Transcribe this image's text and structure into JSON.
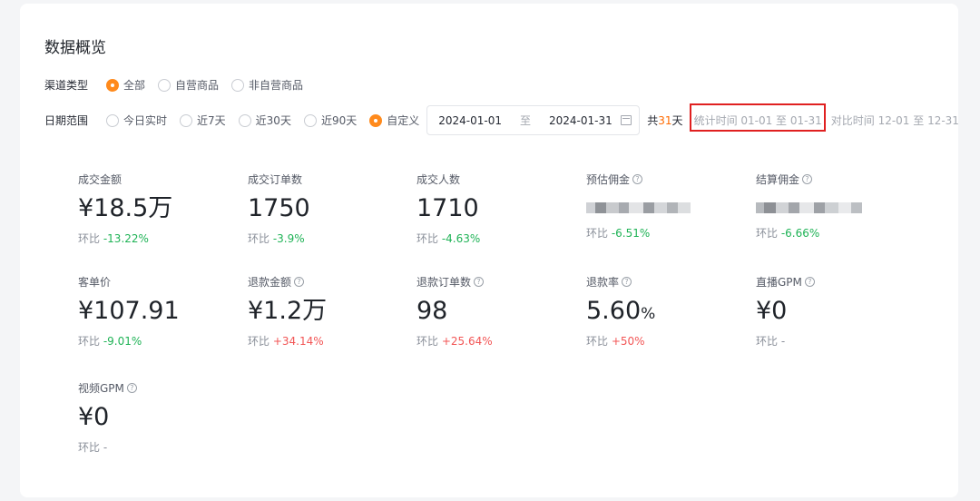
{
  "page_title": "数据概览",
  "channel": {
    "label": "渠道类型",
    "options": [
      {
        "label": "全部",
        "selected": true
      },
      {
        "label": "自营商品",
        "selected": false
      },
      {
        "label": "非自营商品",
        "selected": false
      }
    ]
  },
  "date": {
    "label": "日期范围",
    "options": [
      {
        "label": "今日实时",
        "selected": false
      },
      {
        "label": "近7天",
        "selected": false
      },
      {
        "label": "近30天",
        "selected": false
      },
      {
        "label": "近90天",
        "selected": false
      },
      {
        "label": "自定义",
        "selected": true
      }
    ],
    "start": "2024-01-01",
    "range_sep": "至",
    "end": "2024-01-31",
    "total_prefix": "共",
    "total_days": "31",
    "total_suffix": "天",
    "stat_time": "统计时间 01-01 至 01-31",
    "compare_time": "对比时间 12-01 至 12-31"
  },
  "metrics": [
    {
      "label": "成交金额",
      "value": "¥18.5万",
      "change_prefix": "环比",
      "change": "-13.22%",
      "trend": "down"
    },
    {
      "label": "成交订单数",
      "value": "1750",
      "change_prefix": "环比",
      "change": "-3.9%",
      "trend": "down"
    },
    {
      "label": "成交人数",
      "value": "1710",
      "change_prefix": "环比",
      "change": "-4.63%",
      "trend": "down"
    },
    {
      "label": "预估佣金",
      "value": "",
      "change_prefix": "环比",
      "change": "-6.51%",
      "trend": "down",
      "help": "?"
    },
    {
      "label": "结算佣金",
      "value": "",
      "change_prefix": "环比",
      "change": "-6.66%",
      "trend": "down",
      "help": "?"
    },
    {
      "label": "客单价",
      "value": "¥107.91",
      "change_prefix": "环比",
      "change": "-9.01%",
      "trend": "down"
    },
    {
      "label": "退款金额",
      "value": "¥1.2万",
      "change_prefix": "环比",
      "change": "+34.14%",
      "trend": "up",
      "help": "?"
    },
    {
      "label": "退款订单数",
      "value": "98",
      "change_prefix": "环比",
      "change": "+25.64%",
      "trend": "up",
      "help": "?"
    },
    {
      "label": "退款率",
      "value": "5.60",
      "unit": "%",
      "change_prefix": "环比",
      "change": "+50%",
      "trend": "up",
      "help": "?"
    },
    {
      "label": "直播GPM",
      "value": "¥0",
      "change_prefix": "环比",
      "change": "-",
      "trend": "none",
      "help": "?"
    },
    {
      "label": "视频GPM",
      "value": "¥0",
      "change_prefix": "环比",
      "change": "-",
      "trend": "none",
      "help": "?"
    }
  ]
}
